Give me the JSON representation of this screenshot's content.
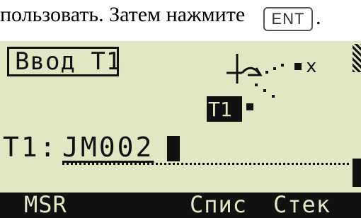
{
  "document": {
    "text": "пользовать. Затем нажмите",
    "key_label": "ENT",
    "trailing": "."
  },
  "screen": {
    "title": "Ввод T1",
    "diagram": {
      "point_x_label": "x",
      "point_t1_label": "T1"
    },
    "field": {
      "label": "T1:",
      "value": "JM002"
    },
    "softkeys": [
      "MSR",
      "Спис",
      "Стек"
    ],
    "colors": {
      "lcd_background": "#dfe7c3",
      "lcd_foreground": "#111111"
    }
  }
}
